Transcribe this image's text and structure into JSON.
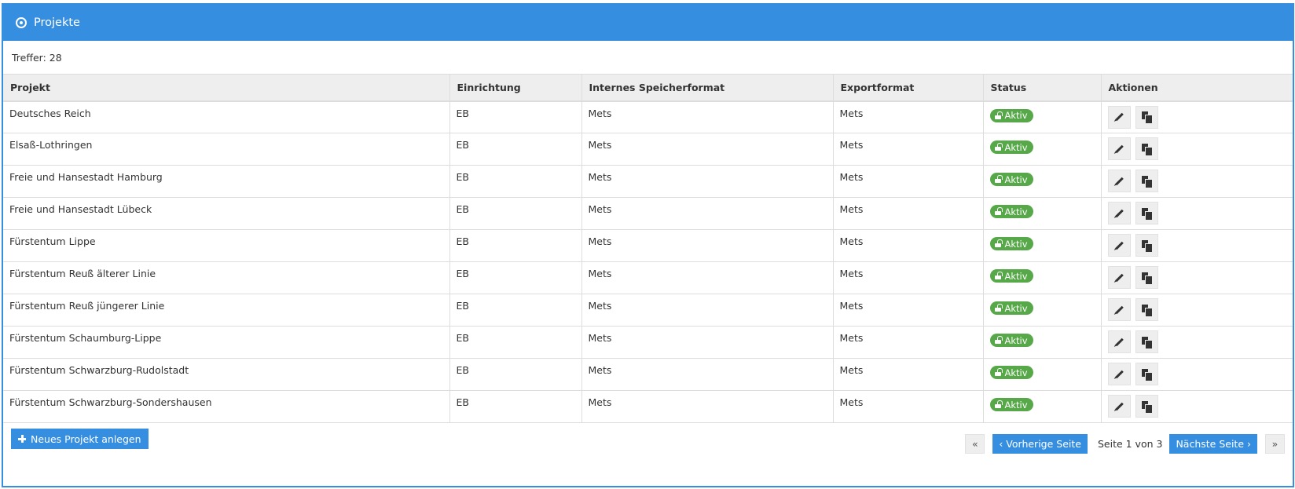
{
  "panel": {
    "title": "Projekte"
  },
  "hits": "Treffer: 28",
  "table": {
    "headers": [
      "Projekt",
      "Einrichtung",
      "Internes Speicherformat",
      "Exportformat",
      "Status",
      "Aktionen"
    ],
    "rows": [
      {
        "projekt": "Deutsches Reich",
        "einrichtung": "EB",
        "speicherformat": "Mets",
        "exportformat": "Mets",
        "status": "Aktiv"
      },
      {
        "projekt": "Elsaß-Lothringen",
        "einrichtung": "EB",
        "speicherformat": "Mets",
        "exportformat": "Mets",
        "status": "Aktiv"
      },
      {
        "projekt": "Freie und Hansestadt Hamburg",
        "einrichtung": "EB",
        "speicherformat": "Mets",
        "exportformat": "Mets",
        "status": "Aktiv"
      },
      {
        "projekt": "Freie und Hansestadt Lübeck",
        "einrichtung": "EB",
        "speicherformat": "Mets",
        "exportformat": "Mets",
        "status": "Aktiv"
      },
      {
        "projekt": "Fürstentum Lippe",
        "einrichtung": "EB",
        "speicherformat": "Mets",
        "exportformat": "Mets",
        "status": "Aktiv"
      },
      {
        "projekt": "Fürstentum Reuß älterer Linie",
        "einrichtung": "EB",
        "speicherformat": "Mets",
        "exportformat": "Mets",
        "status": "Aktiv"
      },
      {
        "projekt": "Fürstentum Reuß jüngerer Linie",
        "einrichtung": "EB",
        "speicherformat": "Mets",
        "exportformat": "Mets",
        "status": "Aktiv"
      },
      {
        "projekt": "Fürstentum Schaumburg-Lippe",
        "einrichtung": "EB",
        "speicherformat": "Mets",
        "exportformat": "Mets",
        "status": "Aktiv"
      },
      {
        "projekt": "Fürstentum Schwarzburg-Rudolstadt",
        "einrichtung": "EB",
        "speicherformat": "Mets",
        "exportformat": "Mets",
        "status": "Aktiv"
      },
      {
        "projekt": "Fürstentum Schwarzburg-Sondershausen",
        "einrichtung": "EB",
        "speicherformat": "Mets",
        "exportformat": "Mets",
        "status": "Aktiv"
      }
    ]
  },
  "footer": {
    "new_project_label": "Neues Projekt anlegen",
    "first_page": "«",
    "prev_page": "‹ Vorherige Seite",
    "page_info": "Seite 1 von 3",
    "next_page": "Nächste Seite ›",
    "last_page": "»"
  },
  "icons": {
    "header": "compass-icon",
    "status": "unlock-icon",
    "edit": "pencil-icon",
    "copy": "copy-icon",
    "new": "plus-icon"
  },
  "colors": {
    "accent": "#368ee0",
    "status_active": "#56a848",
    "header_row": "#eeeeee"
  }
}
